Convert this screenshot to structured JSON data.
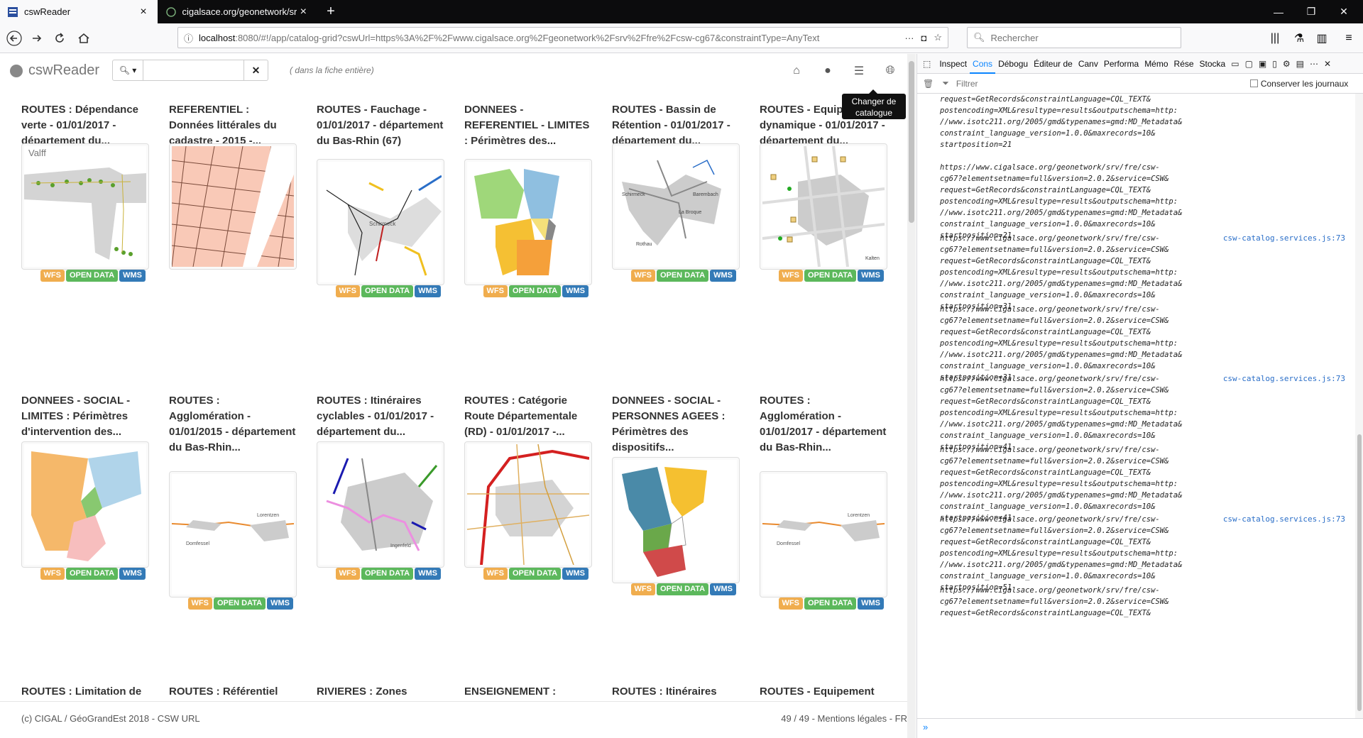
{
  "browser": {
    "tabs": [
      {
        "title": "cswReader",
        "active": true
      },
      {
        "title": "cigalsace.org/geonetwork/srv/",
        "active": false
      }
    ],
    "url_host": "localhost",
    "url_rest": ":8080/#!/app/catalog-grid?cswUrl=https%3A%2F%2Fwww.cigalsace.org%2Fgeonetwork%2Fsrv%2Ffre%2Fcsw-cg67&constraintType=AnyText",
    "url_menu": "···",
    "search_placeholder": "Rechercher"
  },
  "app": {
    "brand": "cswReader",
    "search_value": "",
    "search_hint": "( dans la fiche entière)",
    "tooltip": "Changer de catalogue"
  },
  "badges": {
    "wfs": "WFS",
    "open": "OPEN DATA",
    "wms": "WMS"
  },
  "cards": [
    {
      "title": "ROUTES : Dépendance verte - 01/01/2017 - département du..."
    },
    {
      "title": "REFERENTIEL : Données littérales du cadastre - 2015 -..."
    },
    {
      "title": "ROUTES - Fauchage - 01/01/2017 - département du Bas-Rhin (67)"
    },
    {
      "title": "DONNEES - REFERENTIEL - LIMITES : Périmètres des..."
    },
    {
      "title": "ROUTES - Bassin de Rétention - 01/01/2017 - département du..."
    },
    {
      "title": "ROUTES - Equipement dynamique - 01/01/2017 - département du..."
    },
    {
      "title": "DONNEES - SOCIAL - LIMITES : Périmètres d'intervention des..."
    },
    {
      "title": "ROUTES : Agglomération - 01/01/2015 - département du Bas-Rhin..."
    },
    {
      "title": "ROUTES : Itinéraires cyclables - 01/01/2017 - département du..."
    },
    {
      "title": "ROUTES : Catégorie Route Départementale (RD) - 01/01/2017 -..."
    },
    {
      "title": "DONNEES - SOCIAL - PERSONNES AGEES : Périmètres des dispositifs..."
    },
    {
      "title": "ROUTES : Agglomération - 01/01/2017 - département du Bas-Rhin..."
    },
    {
      "title": "ROUTES : Limitation de"
    },
    {
      "title": "ROUTES : Référentiel"
    },
    {
      "title": "RIVIERES : Zones"
    },
    {
      "title": "ENSEIGNEMENT :"
    },
    {
      "title": "ROUTES : Itinéraires"
    },
    {
      "title": "ROUTES - Equipement"
    }
  ],
  "map_labels": {
    "valff": "Valff",
    "schirmeck": "Schirmeck",
    "barembach": "Barembach",
    "la_broque": "La Broque",
    "rothau": "Rothau",
    "kalten": "Kalten",
    "lorentzen": "Lorentzen",
    "domfessel": "Domfessel",
    "ingenfeld": "Ingenfeld"
  },
  "footer": {
    "left": "(c) CIGAL / GéoGrandEst 2018 - CSW URL",
    "right": "49 / 49 - Mentions légales - FR"
  },
  "devtools": {
    "tabs": [
      "Inspect",
      "Cons",
      "Débogu",
      "Éditeur de",
      "Canv",
      "Performa",
      "Mémo",
      "Rése",
      "Stocka"
    ],
    "filter_placeholder": "Filtrer",
    "keep_logs": "Conserver les journaux",
    "logs": [
      {
        "text": "request=GetRecords&constraintLanguage=CQL_TEXT&\npostencoding=XML&resultype=results&outputschema=http:\n//www.isotc211.org/2005/gmd&typenames=gmd:MD_Metadata&\nconstraint_language_version=1.0.0&maxrecords=10&\nstartposition=21",
        "source": ""
      },
      {
        "text": "https://www.cigalsace.org/geonetwork/srv/fre/csw-\ncg67?elementsetname=full&version=2.0.2&service=CSW&\nrequest=GetRecords&constraintLanguage=CQL_TEXT&\npostencoding=XML&resultype=results&outputschema=http:\n//www.isotc211.org/2005/gmd&typenames=gmd:MD_Metadata&\nconstraint_language_version=1.0.0&maxrecords=10&\nstartposition=21",
        "source": ""
      },
      {
        "text": "https://www.cigalsace.org/geonetwork/srv/fre/csw-\ncg67?elementsetname=full&version=2.0.2&service=CSW&\nrequest=GetRecords&constraintLanguage=CQL_TEXT&\npostencoding=XML&resultype=results&outputschema=http:\n//www.isotc211.org/2005/gmd&typenames=gmd:MD_Metadata&\nconstraint_language_version=1.0.0&maxrecords=10&\nstartposition=31",
        "source": "csw-catalog.services.js:73"
      },
      {
        "text": "https://www.cigalsace.org/geonetwork/srv/fre/csw-\ncg67?elementsetname=full&version=2.0.2&service=CSW&\nrequest=GetRecords&constraintLanguage=CQL_TEXT&\npostencoding=XML&resultype=results&outputschema=http:\n//www.isotc211.org/2005/gmd&typenames=gmd:MD_Metadata&\nconstraint_language_version=1.0.0&maxrecords=10&\nstartposition=31",
        "source": ""
      },
      {
        "text": "https://www.cigalsace.org/geonetwork/srv/fre/csw-\ncg67?elementsetname=full&version=2.0.2&service=CSW&\nrequest=GetRecords&constraintLanguage=CQL_TEXT&\npostencoding=XML&resultype=results&outputschema=http:\n//www.isotc211.org/2005/gmd&typenames=gmd:MD_Metadata&\nconstraint_language_version=1.0.0&maxrecords=10&\nstartposition=41",
        "source": "csw-catalog.services.js:73"
      },
      {
        "text": "https://www.cigalsace.org/geonetwork/srv/fre/csw-\ncg67?elementsetname=full&version=2.0.2&service=CSW&\nrequest=GetRecords&constraintLanguage=CQL_TEXT&\npostencoding=XML&resultype=results&outputschema=http:\n//www.isotc211.org/2005/gmd&typenames=gmd:MD_Metadata&\nconstraint_language_version=1.0.0&maxrecords=10&\nstartposition=41",
        "source": ""
      },
      {
        "text": "https://www.cigalsace.org/geonetwork/srv/fre/csw-\ncg67?elementsetname=full&version=2.0.2&service=CSW&\nrequest=GetRecords&constraintLanguage=CQL_TEXT&\npostencoding=XML&resultype=results&outputschema=http:\n//www.isotc211.org/2005/gmd&typenames=gmd:MD_Metadata&\nconstraint_language_version=1.0.0&maxrecords=10&\nstartposition=51",
        "source": "csw-catalog.services.js:73"
      },
      {
        "text": "https://www.cigalsace.org/geonetwork/srv/fre/csw-\ncg67?elementsetname=full&version=2.0.2&service=CSW&\nrequest=GetRecords&constraintLanguage=CQL_TEXT&",
        "source": ""
      }
    ]
  }
}
